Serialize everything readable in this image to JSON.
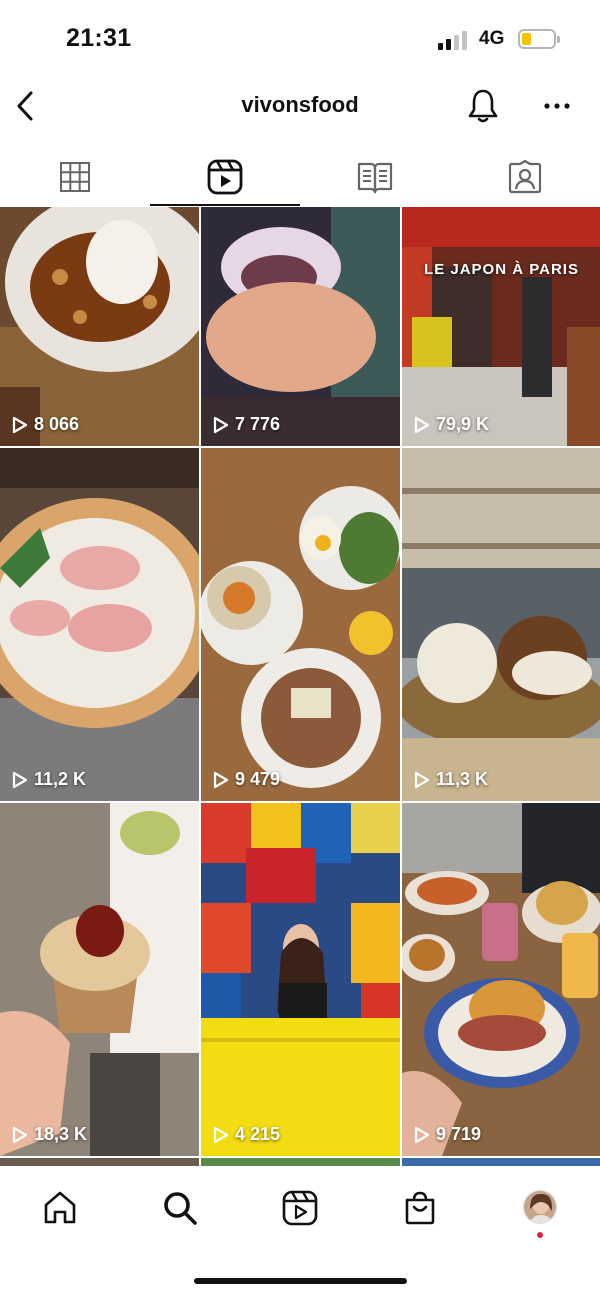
{
  "status_bar": {
    "time": "21:31",
    "network": "4G",
    "battery_color": "#f5c400",
    "battery_level": 0.3,
    "signal_bars_active": 2,
    "signal_bars_total": 4
  },
  "header": {
    "title": "vivonsfood",
    "icons": [
      "chevron-left-icon",
      "bell-icon",
      "more-horizontal-icon"
    ]
  },
  "tabs": [
    {
      "name": "grid",
      "icon": "grid-icon",
      "active": false
    },
    {
      "name": "reels",
      "icon": "reels-icon",
      "active": true
    },
    {
      "name": "guides",
      "icon": "open-book-icon",
      "active": false
    },
    {
      "name": "tagged",
      "icon": "tagged-person-icon",
      "active": false
    }
  ],
  "reels": [
    {
      "views": "8 066",
      "subject": "dessert with ice cream"
    },
    {
      "views": "7 776",
      "subject": "stuffed mochi"
    },
    {
      "views": "79,9 K",
      "subject": "japanese market",
      "caption": "LE JAPON À PARIS"
    },
    {
      "views": "11,2 K",
      "subject": "ham pizza"
    },
    {
      "views": "9 479",
      "subject": "brunch table"
    },
    {
      "views": "11,3 K",
      "subject": "bao buns"
    },
    {
      "views": "18,3 K",
      "subject": "dessert cup"
    },
    {
      "views": "4 215",
      "subject": "yellow bar"
    },
    {
      "views": "9 719",
      "subject": "burger plate"
    }
  ],
  "bottom_nav": [
    {
      "name": "home",
      "icon": "home-icon"
    },
    {
      "name": "search",
      "icon": "search-icon"
    },
    {
      "name": "reels",
      "icon": "reels-icon"
    },
    {
      "name": "shop",
      "icon": "shopping-bag-icon"
    },
    {
      "name": "profile",
      "icon": "avatar-icon"
    }
  ],
  "colors": {
    "text": "#111111",
    "notification_dot": "#ed1c3a",
    "background": "#ffffff"
  }
}
